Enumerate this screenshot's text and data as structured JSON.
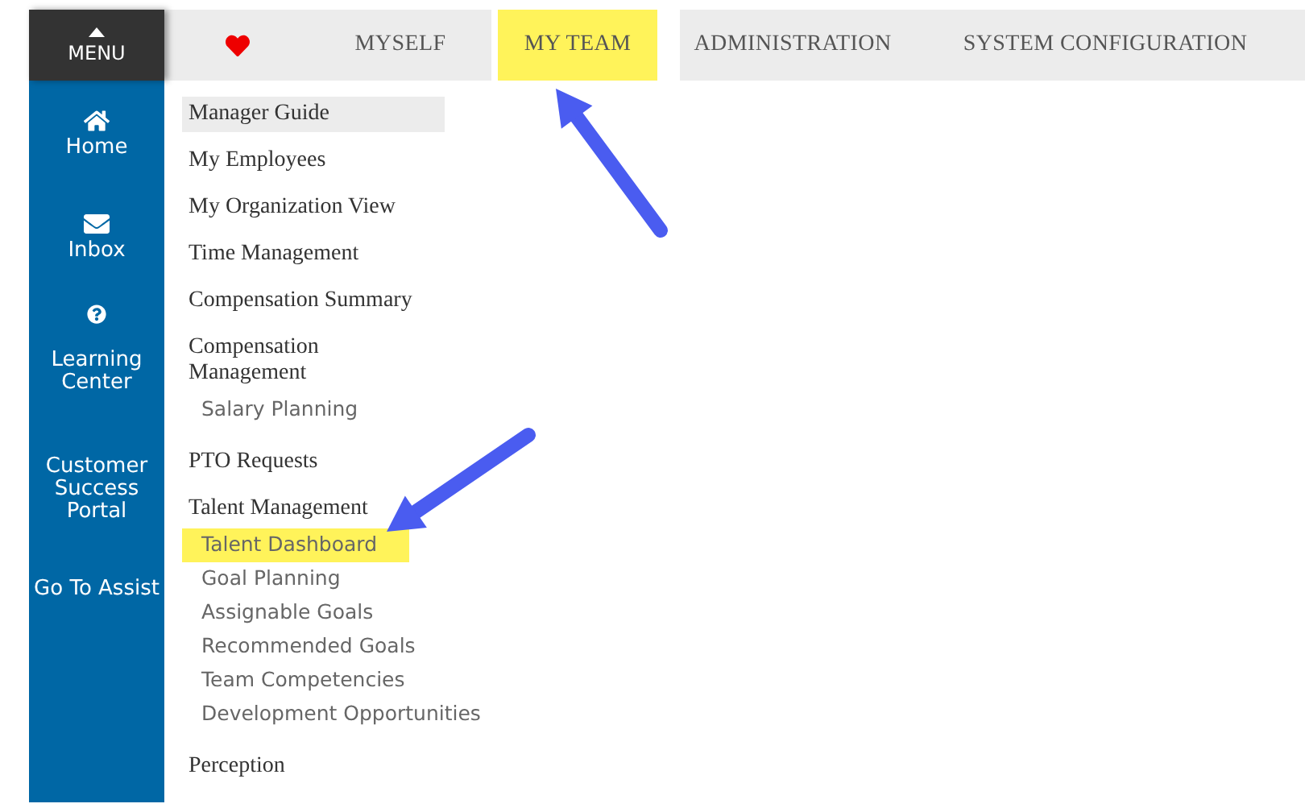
{
  "menu_button": {
    "label": "MENU"
  },
  "top_tabs": [
    {
      "kind": "heart",
      "highlighted": false
    },
    {
      "kind": "text",
      "label": "MYSELF",
      "highlighted": false
    },
    {
      "kind": "text",
      "label": "MY TEAM",
      "highlighted": true
    },
    {
      "kind": "text",
      "label": "ADMINISTRATION",
      "highlighted": false
    },
    {
      "kind": "text",
      "label": "SYSTEM CONFIGURATION",
      "highlighted": false
    }
  ],
  "sidebar": {
    "items": [
      {
        "label": "Home"
      },
      {
        "label": "Inbox"
      },
      {
        "label": "Learning Center"
      },
      {
        "label": "Customer Success Portal"
      },
      {
        "label": "Go To Assist"
      }
    ]
  },
  "menu_sections": [
    {
      "label": "Manager Guide",
      "selected": true
    },
    {
      "label": "My Employees",
      "selected": false
    },
    {
      "label": "My Organization View",
      "selected": false
    },
    {
      "label": "Time Management",
      "selected": false
    },
    {
      "label": "Compensation Summary",
      "selected": false
    },
    {
      "label": "Compensation Management",
      "selected": false,
      "children": [
        {
          "label": "Salary Planning",
          "highlighted": false
        }
      ]
    },
    {
      "label": "PTO Requests",
      "selected": false
    },
    {
      "label": "Talent Management",
      "selected": false,
      "children": [
        {
          "label": "Talent Dashboard",
          "highlighted": true
        },
        {
          "label": "Goal Planning",
          "highlighted": false
        },
        {
          "label": "Assignable Goals",
          "highlighted": false
        },
        {
          "label": "Recommended Goals",
          "highlighted": false
        },
        {
          "label": "Team Competencies",
          "highlighted": false
        },
        {
          "label": "Development Opportunities",
          "highlighted": false
        }
      ]
    },
    {
      "label": "Perception",
      "selected": false
    }
  ]
}
